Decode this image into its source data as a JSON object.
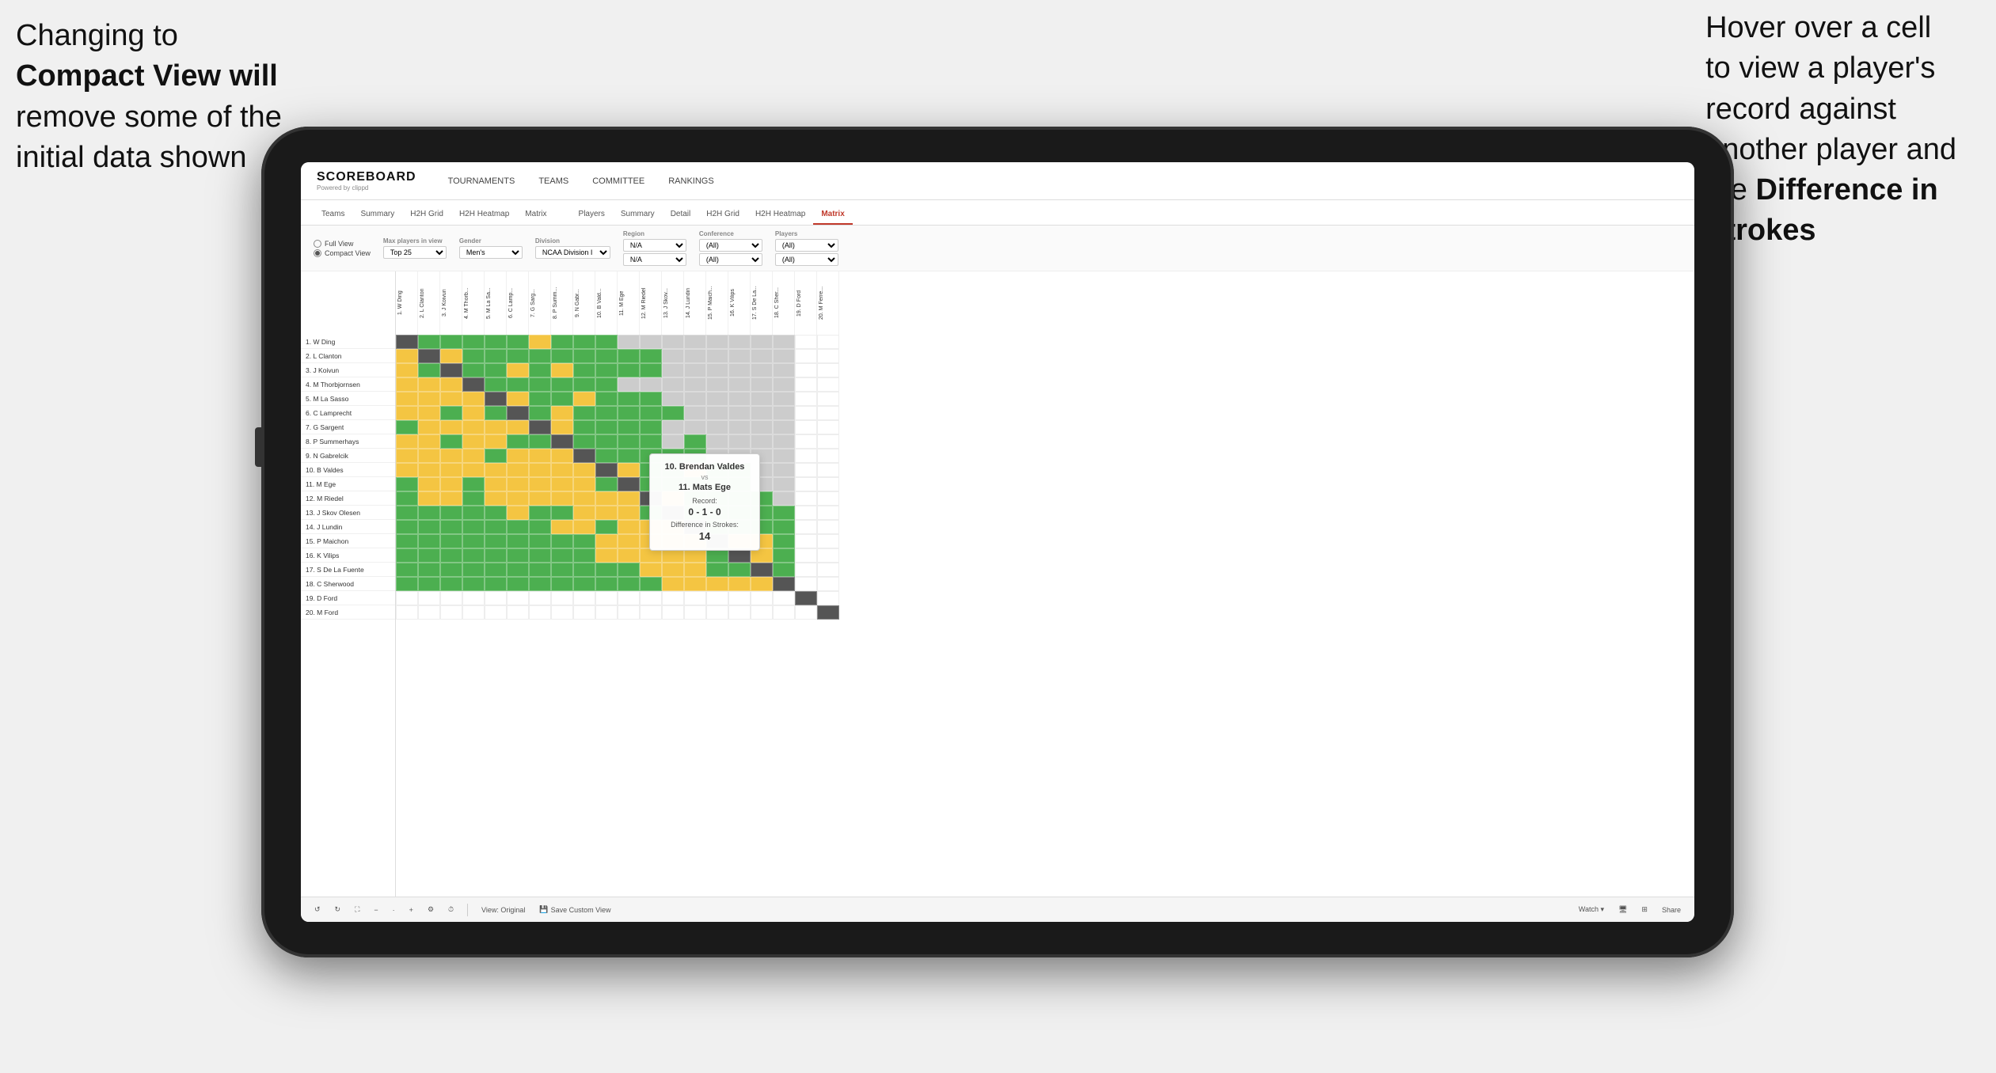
{
  "annotations": {
    "left": {
      "line1": "Changing to",
      "line2": "Compact View will",
      "line3": "remove some of the",
      "line4": "initial data shown"
    },
    "right": {
      "line1": "Hover over a cell",
      "line2": "to view a player's",
      "line3": "record against",
      "line4": "another player and",
      "line5": "the ",
      "bold5": "Difference in",
      "line6": "Strokes"
    }
  },
  "app": {
    "logo": "SCOREBOARD",
    "logo_sub": "Powered by clippd",
    "nav": [
      "TOURNAMENTS",
      "TEAMS",
      "COMMITTEE",
      "RANKINGS"
    ]
  },
  "sub_tabs": {
    "group1": [
      "Teams",
      "Summary",
      "H2H Grid",
      "H2H Heatmap",
      "Matrix"
    ],
    "group2": [
      "Players",
      "Summary",
      "Detail",
      "H2H Grid",
      "H2H Heatmap",
      "Matrix"
    ],
    "active": "Matrix"
  },
  "filters": {
    "view_options": [
      "Full View",
      "Compact View"
    ],
    "selected_view": "Compact View",
    "max_players_label": "Max players in view",
    "max_players_value": "Top 25",
    "gender_label": "Gender",
    "gender_value": "Men's",
    "division_label": "Division",
    "division_value": "NCAA Division I",
    "region_label": "Region",
    "region_value": "N/A",
    "region_value2": "N/A",
    "conference_label": "Conference",
    "conference_value": "(All)",
    "conference_value2": "(All)",
    "players_label": "Players",
    "players_value": "(All)",
    "players_value2": "(All)"
  },
  "players": [
    "1. W Ding",
    "2. L Clanton",
    "3. J Koivun",
    "4. M Thorbjornsen",
    "5. M La Sasso",
    "6. C Lamprecht",
    "7. G Sargent",
    "8. P Summerhays",
    "9. N Gabrelcik",
    "10. B Valdes",
    "11. M Ege",
    "12. M Riedel",
    "13. J Skov Olesen",
    "14. J Lundin",
    "15. P Maichon",
    "16. K Vilips",
    "17. S De La Fuente",
    "18. C Sherwood",
    "19. D Ford",
    "20. M Ford"
  ],
  "col_headers": [
    "1. W Ding",
    "2. L Clanton",
    "3. J Koivun",
    "4. M Thorb...",
    "5. M La Sa...",
    "6. C Lamp...",
    "7. G Sarg...",
    "8. P Summ...",
    "9. N Gabr...",
    "10. B Vald...",
    "11. M Ege",
    "12. M Riedel",
    "13. J Skov...",
    "14. J Lundin",
    "15. P Maich...",
    "16. K Vilips",
    "17. S De La...",
    "18. C Sher...",
    "19. D Ford",
    "20. M Ferre..."
  ],
  "tooltip": {
    "player1": "10. Brendan Valdes",
    "vs": "vs",
    "player2": "11. Mats Ege",
    "record_label": "Record:",
    "record": "0 - 1 - 0",
    "diff_label": "Difference in Strokes:",
    "diff": "14"
  },
  "toolbar": {
    "undo": "↺",
    "redo": "↻",
    "zoom_in": "+",
    "zoom_out": "-",
    "view_original": "View: Original",
    "save_custom": "Save Custom View",
    "watch": "Watch ▾",
    "share": "Share"
  }
}
